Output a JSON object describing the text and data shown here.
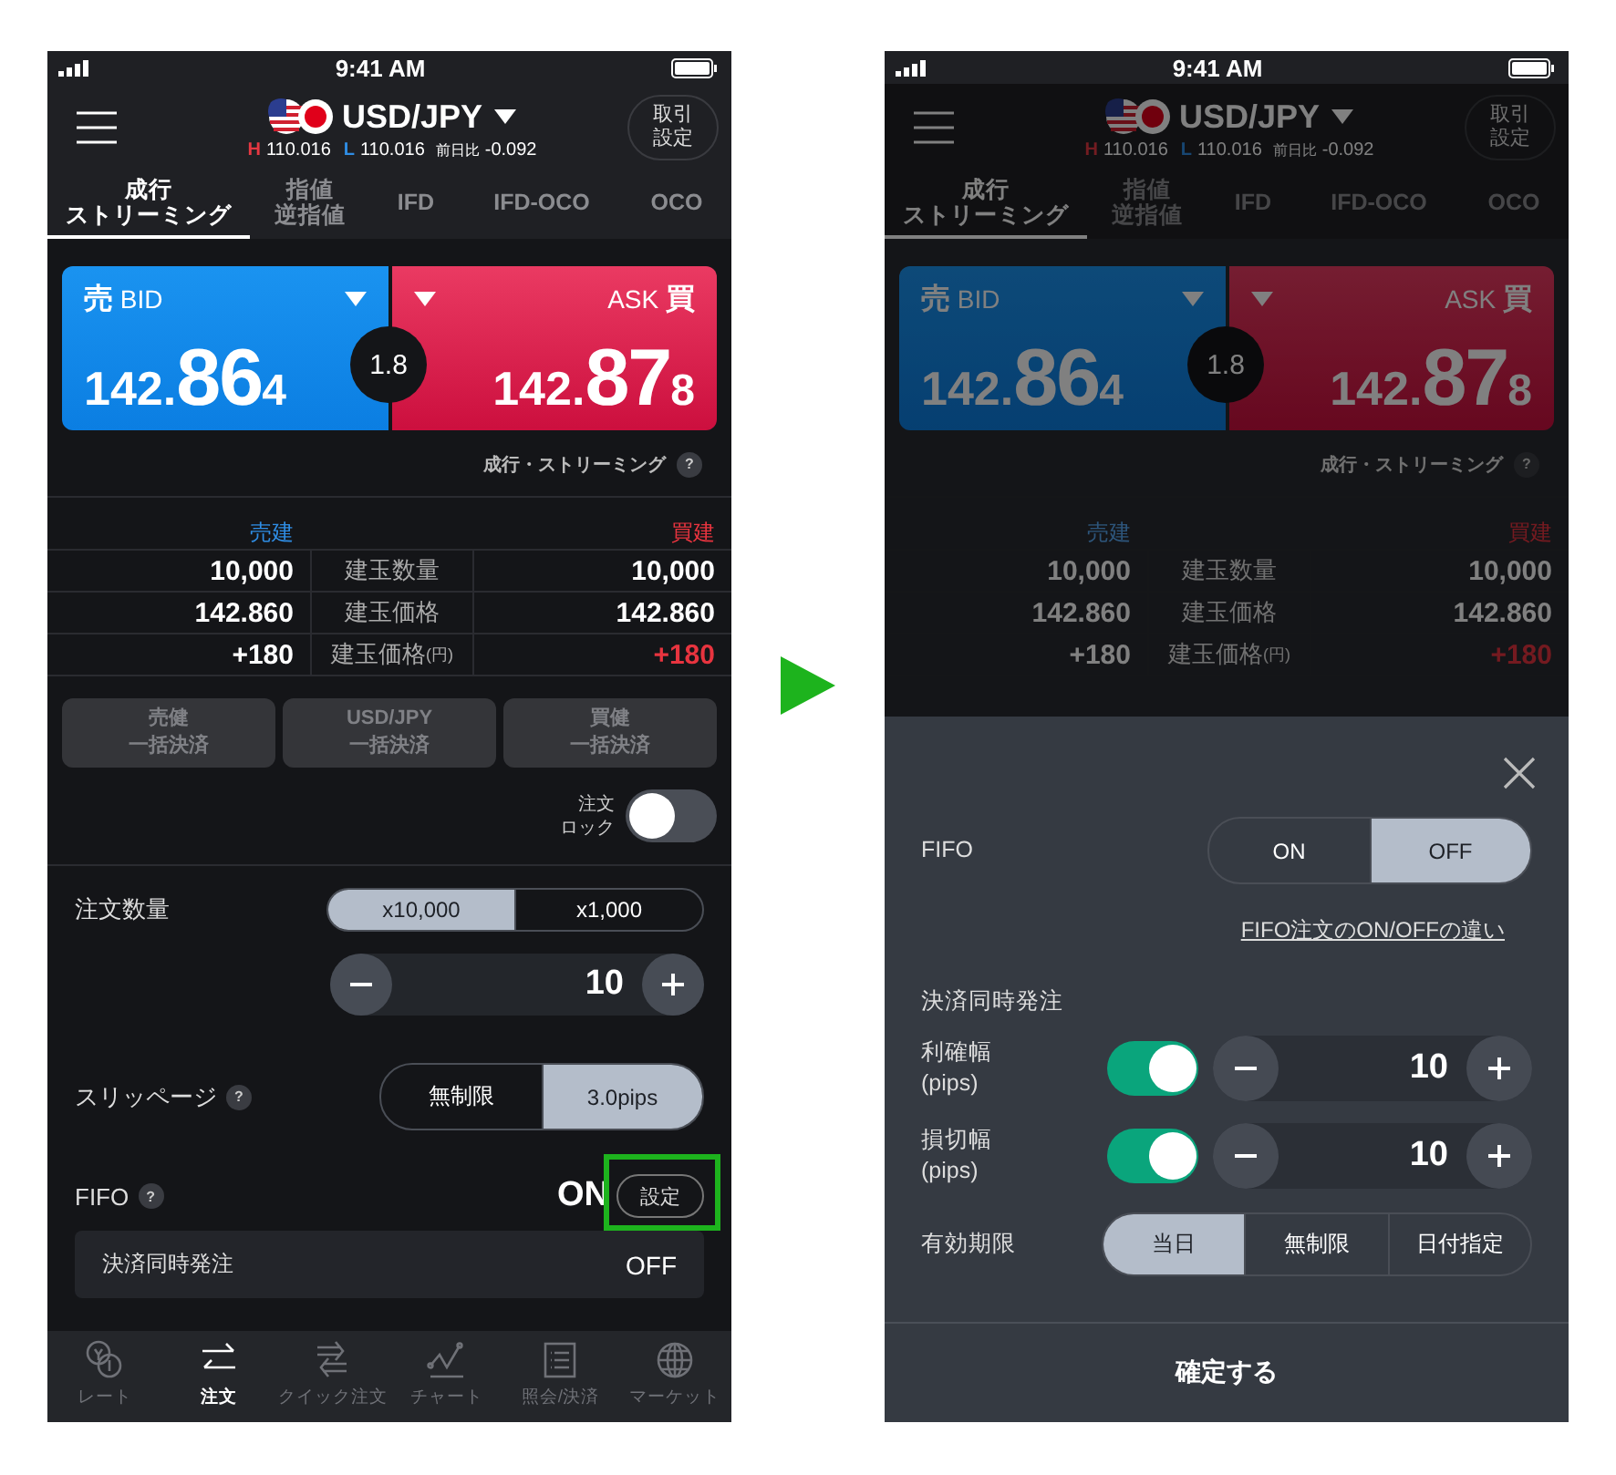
{
  "left_screen": {
    "status_bar": {
      "time": "9:41 AM"
    },
    "header": {
      "pair": "USD/JPY",
      "high_label": "H",
      "high": "110.016",
      "low_label": "L",
      "low": "110.016",
      "change_label": "前日比",
      "change": "-0.092",
      "settings_button": [
        "取引",
        "設定"
      ]
    },
    "tabs": [
      {
        "lines": [
          "成行",
          "ストリーミング"
        ],
        "selected": true
      },
      {
        "lines": [
          "指値",
          "逆指値"
        ],
        "selected": false
      },
      {
        "lines": [
          "IFD"
        ],
        "selected": false
      },
      {
        "lines": [
          "IFD-OCO"
        ],
        "selected": false
      },
      {
        "lines": [
          "OCO"
        ],
        "selected": false
      }
    ],
    "quote": {
      "bid": {
        "side": "売",
        "label": "BID",
        "price_head": "142.",
        "price_big": "86",
        "price_tail": "4"
      },
      "ask": {
        "side": "買",
        "label": "ASK",
        "price_head": "142.",
        "price_big": "87",
        "price_tail": "8"
      },
      "spread": "1.8",
      "mode_label": "成行・ストリーミング",
      "help": "?"
    },
    "positions": {
      "sell_header": "売建",
      "buy_header": "買建",
      "rows": [
        {
          "sell": "10,000",
          "label": "建玉数量",
          "buy": "10,000",
          "buy_emphasis": false
        },
        {
          "sell": "142.860",
          "label": "建玉価格",
          "buy": "142.860",
          "buy_emphasis": false
        },
        {
          "sell": "+180",
          "label": "建玉価格",
          "label_suffix": "(円)",
          "buy": "+180",
          "buy_emphasis": true
        }
      ]
    },
    "bulk_close": [
      {
        "lines": [
          "売健",
          "一括決済"
        ],
        "disabled": true
      },
      {
        "lines": [
          "USD/JPY",
          "一括決済"
        ],
        "disabled": true
      },
      {
        "lines": [
          "買健",
          "一括決済"
        ],
        "disabled": true
      }
    ],
    "order_lock": {
      "label": [
        "注文",
        "ロック"
      ],
      "on": false
    },
    "order_quantity": {
      "label": "注文数量",
      "units": [
        {
          "label": "x10,000",
          "selected": true
        },
        {
          "label": "x1,000",
          "selected": false
        }
      ],
      "value": "10"
    },
    "slippage": {
      "label": "スリッページ",
      "help": "?",
      "options": [
        {
          "label": "無制限",
          "selected": false
        },
        {
          "label": "3.0pips",
          "selected": true
        }
      ]
    },
    "fifo": {
      "label": "FIFO",
      "help": "?",
      "value": "ON",
      "settings_button": "設定",
      "highlighted": true
    },
    "settlement": {
      "label": "決済同時発注",
      "value": "OFF"
    },
    "tab_bar": [
      {
        "kind": "rate",
        "label": "レート",
        "selected": false
      },
      {
        "kind": "order",
        "label": "注文",
        "selected": true
      },
      {
        "kind": "quick",
        "label": "クイック注文",
        "selected": false
      },
      {
        "kind": "chart",
        "label": "チャート",
        "selected": false
      },
      {
        "kind": "inquiry",
        "label": "照会/決済",
        "selected": false
      },
      {
        "kind": "market",
        "label": "マーケット",
        "selected": false
      }
    ]
  },
  "right_screen": {
    "status_bar": {
      "time": "9:41 AM"
    },
    "background": {
      "header": {
        "pair": "USD/JPY",
        "high_label": "H",
        "high": "110.016",
        "low_label": "L",
        "low": "110.016",
        "change_label": "前日比",
        "change": "-0.092",
        "settings_button": [
          "取引",
          "設定"
        ]
      },
      "tabs": [
        {
          "lines": [
            "成行",
            "ストリーミング"
          ],
          "selected": true
        },
        {
          "lines": [
            "指値",
            "逆指値"
          ],
          "selected": false
        },
        {
          "lines": [
            "IFD"
          ],
          "selected": false
        },
        {
          "lines": [
            "IFD-OCO"
          ],
          "selected": false
        },
        {
          "lines": [
            "OCO"
          ],
          "selected": false
        }
      ],
      "quote": {
        "bid": {
          "side": "売",
          "label": "BID",
          "price_head": "142.",
          "price_big": "86",
          "price_tail": "4"
        },
        "ask": {
          "side": "買",
          "label": "ASK",
          "price_head": "142.",
          "price_big": "87",
          "price_tail": "8"
        },
        "spread": "1.8",
        "mode_label": "成行・ストリーミング",
        "help": "?"
      },
      "positions": {
        "sell_header": "売建",
        "buy_header": "買建",
        "rows": [
          {
            "sell": "10,000",
            "label": "建玉数量",
            "buy": "10,000",
            "buy_emphasis": false
          },
          {
            "sell": "142.860",
            "label": "建玉価格",
            "buy": "142.860",
            "buy_emphasis": false
          },
          {
            "sell": "+180",
            "label": "建玉価格",
            "label_suffix": "(円)",
            "buy": "+180",
            "buy_emphasis": true
          }
        ]
      }
    },
    "fifo_sheet": {
      "fifo_label": "FIFO",
      "fifo_options": [
        {
          "label": "ON",
          "selected": false
        },
        {
          "label": "OFF",
          "selected": true
        }
      ],
      "difference_link": "FIFO注文のON/OFFの違い",
      "settlement_title": "決済同時発注",
      "limits": [
        {
          "label": [
            "利確幅",
            "(pips)"
          ],
          "on": true,
          "value": "10"
        },
        {
          "label": [
            "損切幅",
            "(pips)"
          ],
          "on": true,
          "value": "10"
        }
      ],
      "expiry_label": "有効期限",
      "expiry_options": [
        {
          "label": "当日",
          "selected": true
        },
        {
          "label": "無制限",
          "selected": false
        },
        {
          "label": "日付指定",
          "selected": false
        }
      ],
      "confirm_button": "確定する"
    }
  }
}
